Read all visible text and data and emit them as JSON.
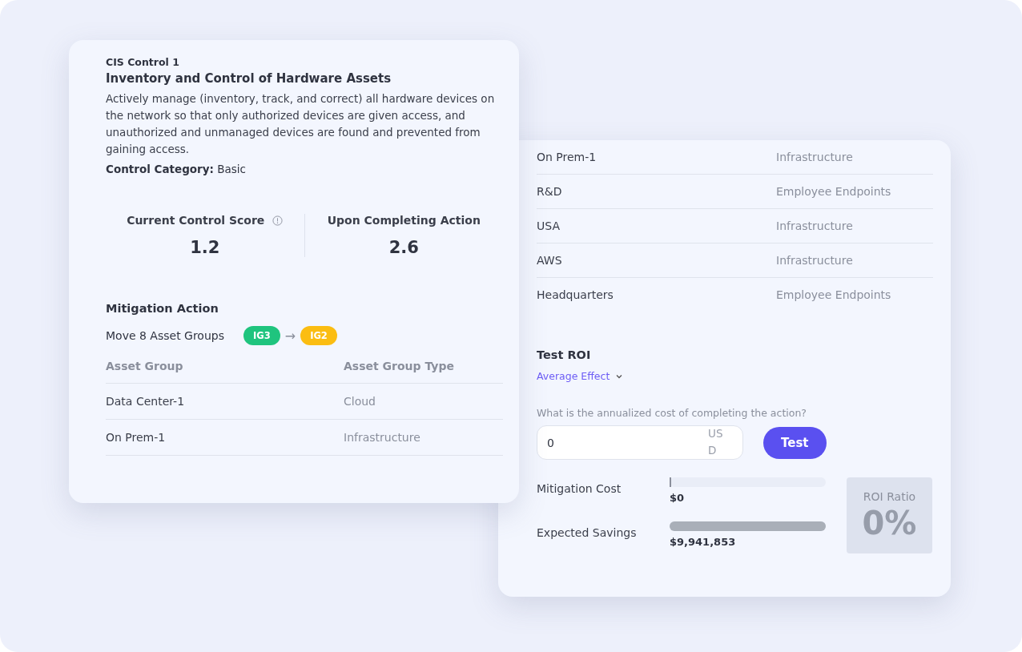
{
  "control_card": {
    "eyebrow": "CIS Control 1",
    "title": "Inventory and Control of Hardware Assets",
    "description": "Actively manage (inventory, track, and correct) all hardware devices on the network so that only authorized devices are given access, and unauthorized and unmanaged devices are found and prevented from gaining access.",
    "category_label": "Control Category:",
    "category_value": "Basic",
    "scores": [
      {
        "label": "Current Control Score",
        "value": "1.2",
        "info": true
      },
      {
        "label": "Upon Completing Action",
        "value": "2.6",
        "info": false
      }
    ],
    "mitigation": {
      "title": "Mitigation Action",
      "action": "Move 8 Asset Groups",
      "from": {
        "label": "IG3",
        "color": "#1fc47e"
      },
      "arrow": "→",
      "to": {
        "label": "IG2",
        "color": "#fbbd12"
      }
    },
    "table": {
      "columns": [
        "Asset Group",
        "Asset Group Type"
      ],
      "rows": [
        [
          "Data Center-1",
          "Cloud"
        ],
        [
          "On Prem-1",
          "Infrastructure"
        ]
      ]
    }
  },
  "roi_card": {
    "rows": [
      [
        "On Prem-1",
        "Infrastructure"
      ],
      [
        "R&D",
        "Employee Endpoints"
      ],
      [
        "USA",
        "Infrastructure"
      ],
      [
        "AWS",
        "Infrastructure"
      ],
      [
        "Headquarters",
        "Employee Endpoints"
      ]
    ],
    "title": "Test ROI",
    "effect_dropdown": "Average Effect",
    "question": "What is the annualized cost of completing the action?",
    "cost_field": {
      "value": "0",
      "unit": "USD"
    },
    "test_button": "Test",
    "bars": [
      {
        "label": "Mitigation Cost",
        "level": 0,
        "amount": "$0"
      },
      {
        "label": "Expected Savings",
        "level": 1,
        "amount": "$9,941,853"
      }
    ],
    "ratio": {
      "label": "ROI Ratio",
      "value": "0%"
    }
  }
}
